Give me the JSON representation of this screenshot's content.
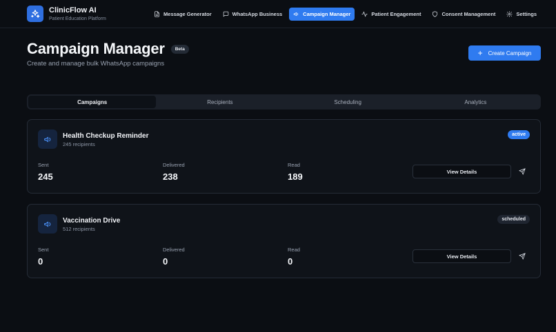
{
  "brand": {
    "name": "ClinicFlow AI",
    "subtitle": "Patient Education Platform",
    "icon": "sparkles-icon"
  },
  "nav": [
    {
      "label": "Message Generator",
      "icon": "file-text-icon"
    },
    {
      "label": "WhatsApp Business",
      "icon": "message-square-icon"
    },
    {
      "label": "Campaign Manager",
      "icon": "megaphone-icon",
      "active": true
    },
    {
      "label": "Patient Engagement",
      "icon": "activity-icon"
    },
    {
      "label": "Consent Management",
      "icon": "shield-icon"
    },
    {
      "label": "Settings",
      "icon": "gear-icon"
    }
  ],
  "header": {
    "title": "Campaign Manager",
    "badge": "Beta",
    "subtitle": "Create and manage bulk WhatsApp campaigns",
    "create_label": "Create Campaign"
  },
  "tabs": [
    {
      "label": "Campaigns",
      "active": true
    },
    {
      "label": "Recipients"
    },
    {
      "label": "Scheduling"
    },
    {
      "label": "Analytics"
    }
  ],
  "stats_labels": {
    "sent": "Sent",
    "delivered": "Delivered",
    "read": "Read"
  },
  "campaigns": [
    {
      "name": "Health Checkup Reminder",
      "recipients": "245 recipients",
      "status": "active",
      "sent": "245",
      "delivered": "238",
      "read": "189",
      "details_label": "View Details"
    },
    {
      "name": "Vaccination Drive",
      "recipients": "512 recipients",
      "status": "scheduled",
      "sent": "0",
      "delivered": "0",
      "read": "0",
      "details_label": "View Details"
    }
  ],
  "colors": {
    "accent": "#2f7bf0",
    "background": "#0b0e13",
    "card": "#0f1319",
    "status_active": "#2f7bf0",
    "status_scheduled": "#1f2530"
  }
}
